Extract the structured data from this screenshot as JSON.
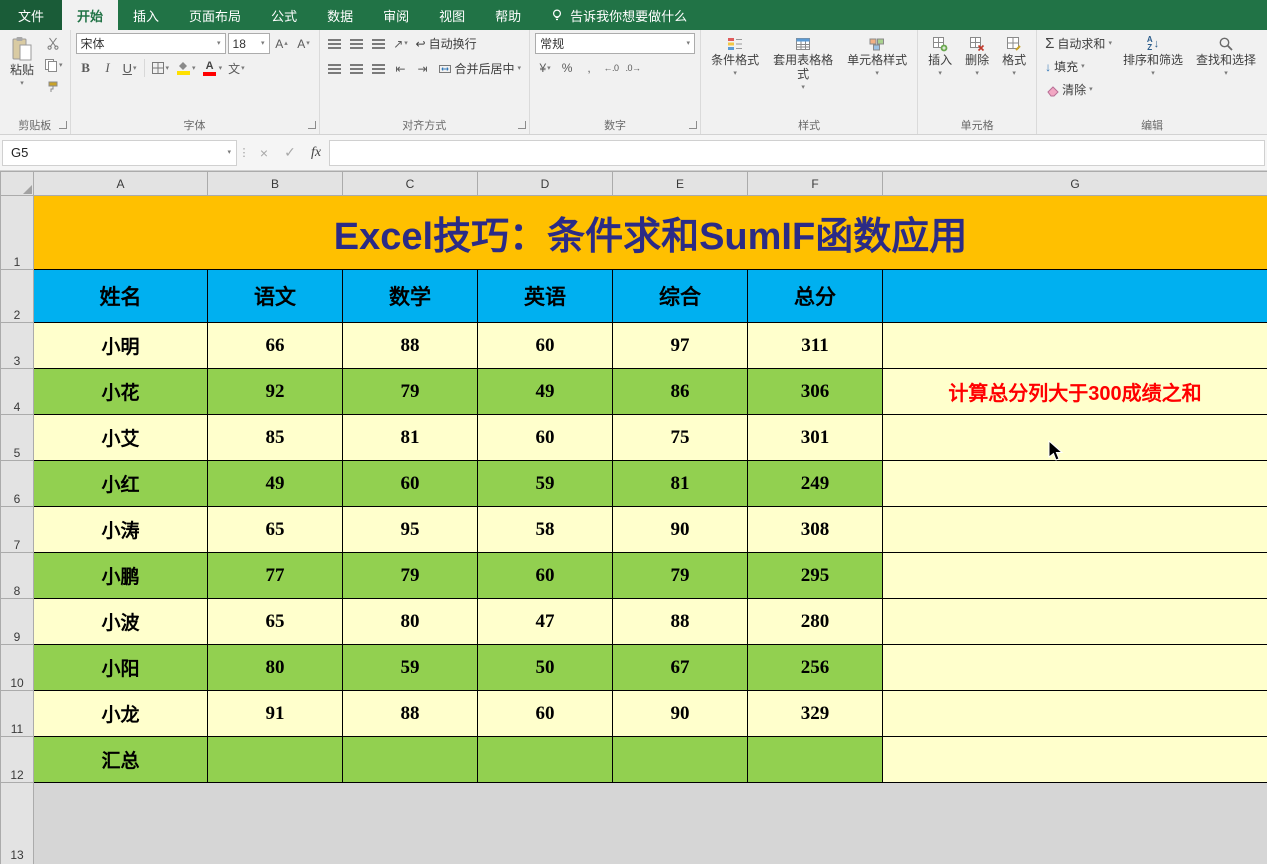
{
  "tell_me": "告诉我你想要做什么",
  "tabs": [
    "文件",
    "开始",
    "插入",
    "页面布局",
    "公式",
    "数据",
    "审阅",
    "视图",
    "帮助"
  ],
  "ribbon": {
    "clipboard": {
      "group_label": "剪贴板",
      "paste": "粘贴"
    },
    "font": {
      "group_label": "字体",
      "font_name": "宋体",
      "font_size": "18"
    },
    "alignment": {
      "group_label": "对齐方式",
      "wrap_text": "自动换行",
      "merge_center": "合并后居中"
    },
    "number": {
      "group_label": "数字",
      "format": "常规"
    },
    "styles": {
      "group_label": "样式",
      "conditional_formatting": "条件格式",
      "format_as_table": "套用表格格式",
      "cell_styles": "单元格样式"
    },
    "cells": {
      "group_label": "单元格",
      "insert": "插入",
      "delete": "删除",
      "format": "格式"
    },
    "editing": {
      "group_label": "编辑",
      "autosum": "自动求和",
      "fill": "填充",
      "clear": "清除",
      "sort_filter": "排序和筛选",
      "find_select": "查找和选择"
    }
  },
  "formula_bar": {
    "name_box": "G5",
    "formula": ""
  },
  "sheet": {
    "column_headers": [
      "A",
      "B",
      "C",
      "D",
      "E",
      "F",
      "G"
    ],
    "row_numbers": [
      "1",
      "2",
      "3",
      "4",
      "5",
      "6",
      "7",
      "8",
      "9",
      "10",
      "11",
      "12",
      "13"
    ],
    "title": "Excel技巧：条件求和SumIF函数应用",
    "table_headers": [
      "姓名",
      "语文",
      "数学",
      "英语",
      "综合",
      "总分"
    ],
    "rows": [
      {
        "name": "小明",
        "values": [
          "66",
          "88",
          "60",
          "97",
          "311"
        ]
      },
      {
        "name": "小花",
        "values": [
          "92",
          "79",
          "49",
          "86",
          "306"
        ]
      },
      {
        "name": "小艾",
        "values": [
          "85",
          "81",
          "60",
          "75",
          "301"
        ]
      },
      {
        "name": "小红",
        "values": [
          "49",
          "60",
          "59",
          "81",
          "249"
        ]
      },
      {
        "name": "小涛",
        "values": [
          "65",
          "95",
          "58",
          "90",
          "308"
        ]
      },
      {
        "name": "小鹏",
        "values": [
          "77",
          "79",
          "60",
          "79",
          "295"
        ]
      },
      {
        "name": "小波",
        "values": [
          "65",
          "80",
          "47",
          "88",
          "280"
        ]
      },
      {
        "name": "小阳",
        "values": [
          "80",
          "59",
          "50",
          "67",
          "256"
        ]
      },
      {
        "name": "小龙",
        "values": [
          "91",
          "88",
          "60",
          "90",
          "329"
        ]
      }
    ],
    "summary_label": "汇总",
    "g_note": "计算总分列大于300成绩之和"
  },
  "icons": {
    "caret": "▾",
    "caret_up": "▴",
    "sigma": "Σ",
    "percent": "%",
    "currency": "¥",
    "comma": ",",
    "check": "✓",
    "cross": "×",
    "dots": "⋮",
    "bold": "B",
    "italic": "I",
    "underline": "U",
    "wrap": "↩",
    "orientation": "↗",
    "indent_left": "⇤",
    "indent_right": "⇥",
    "arrow_down": "↓",
    "increase_decimal": "←.0",
    "decrease_decimal": ".0→",
    "letter_a": "A",
    "letter_z": "Z",
    "phonetic": "文",
    "fx": "fx"
  },
  "colors": {
    "excel_green": "#217346",
    "title_bg": "#FFC000",
    "title_text": "#2B2B86",
    "header_row_bg": "#00B0F0",
    "row_yellow": "#FFFFCC",
    "row_green": "#92D050",
    "note_red": "#FF0000"
  }
}
